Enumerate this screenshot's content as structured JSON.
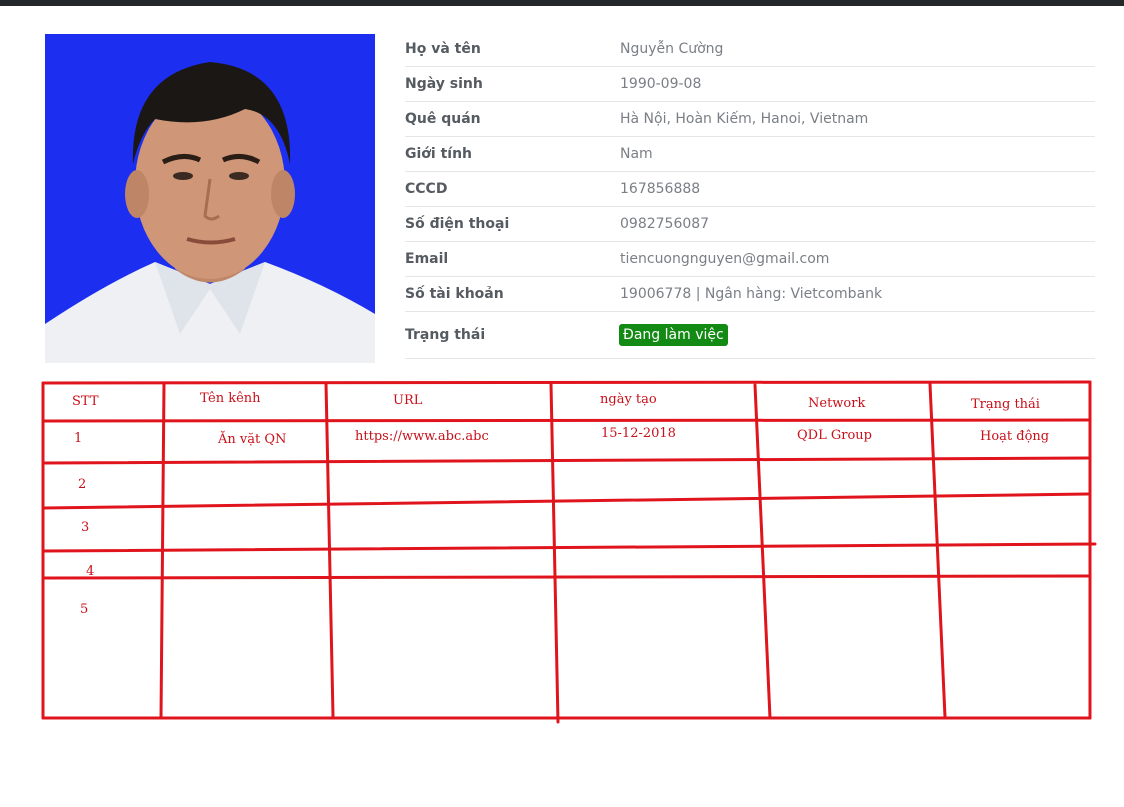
{
  "profile": {
    "fields": [
      {
        "label": "Họ và tên",
        "value": "Nguyễn Cường"
      },
      {
        "label": "Ngày sinh",
        "value": "1990-09-08"
      },
      {
        "label": "Quê quán",
        "value": "Hà Nội, Hoàn Kiếm, Hanoi, Vietnam"
      },
      {
        "label": "Giới tính",
        "value": "Nam"
      },
      {
        "label": "CCCD",
        "value": "167856888"
      },
      {
        "label": "Số điện thoại",
        "value": "0982756087"
      },
      {
        "label": "Email",
        "value": "tiencuongnguyen@gmail.com"
      },
      {
        "label": "Số tài khoản",
        "value": "19006778 | Ngân hàng: Vietcombank"
      }
    ],
    "status_label": "Trạng thái",
    "status_value": "Đang làm việc",
    "status_color": "#138a13",
    "photo_background": "#1c2ef0"
  },
  "sketch_table": {
    "line_color": "#e0141c",
    "headers": [
      "STT",
      "Tên kênh",
      "URL",
      "ngày tạo",
      "Network",
      "Trạng thái"
    ],
    "rows": [
      [
        "1",
        "Ăn vặt QN",
        "https://www.abc.abc",
        "15-12-2018",
        "QDL Group",
        "Hoạt động"
      ],
      [
        "2",
        "",
        "",
        "",
        "",
        ""
      ],
      [
        "3",
        "",
        "",
        "",
        "",
        ""
      ],
      [
        "4",
        "",
        "",
        "",
        "",
        ""
      ],
      [
        "5",
        "",
        "",
        "",
        "",
        ""
      ]
    ]
  }
}
